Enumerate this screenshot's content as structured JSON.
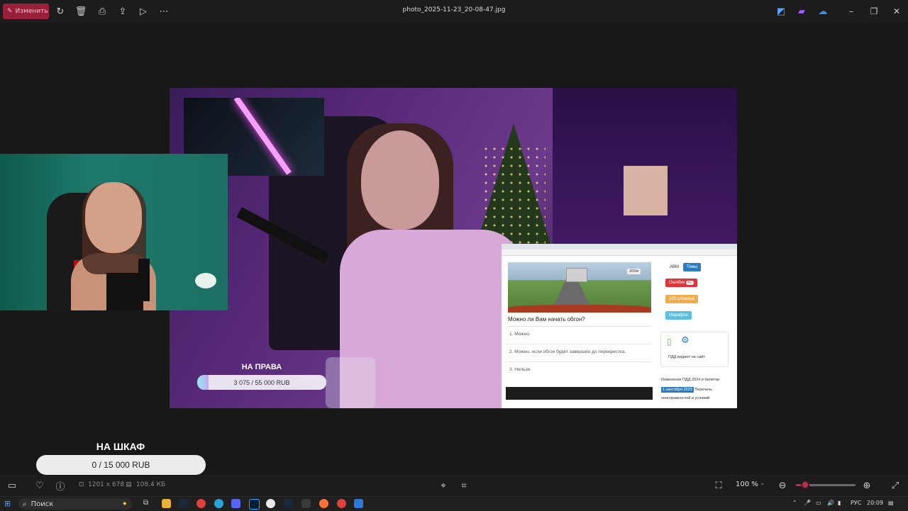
{
  "toolbar": {
    "edit_label": "Изменить",
    "filename": "photo_2025-11-23_20-08-47.jpg"
  },
  "overlay": {
    "goal1_title": "НА ПРАВА",
    "goal1_value": "3 075 / 55 000 RUB",
    "goal1_progress": 0.056,
    "goal2_title": "НА ШКАФ",
    "goal2_value": "0 / 15 000 RUB",
    "goal2_progress": 0.0
  },
  "quiz": {
    "distance_tag": "200м",
    "question": "Можно ли Вам начать обгон?",
    "answers": [
      "1. Можно.",
      "2. Можно, если обгон будет завершен до перекрестка.",
      "3. Нельзя."
    ],
    "side_buttons": {
      "abm": "ABM",
      "themes": "Темы",
      "errors": "Ошибки",
      "errors_count": "42",
      "hard": "100 сложных",
      "marathon": "Марафон"
    },
    "widget_text": "ПДД виджет на сайт",
    "changes_title": "Изменения ПДД 2024 и билетов",
    "changes_date": "1 сентября 2023",
    "changes_text_1": "Перечень",
    "changes_text_2": "неисправностей и условий"
  },
  "status": {
    "dimensions": "1201 x 678",
    "file_size": "108.4 КБ",
    "zoom": "100 %",
    "zoom_slider": 0.1
  },
  "taskbar": {
    "search_placeholder": "Поиск",
    "language": "РУС",
    "time": "20:09"
  },
  "colors": {
    "accent": "#b8324e",
    "edit_button": "#9a1f3a",
    "background": "#181818"
  }
}
